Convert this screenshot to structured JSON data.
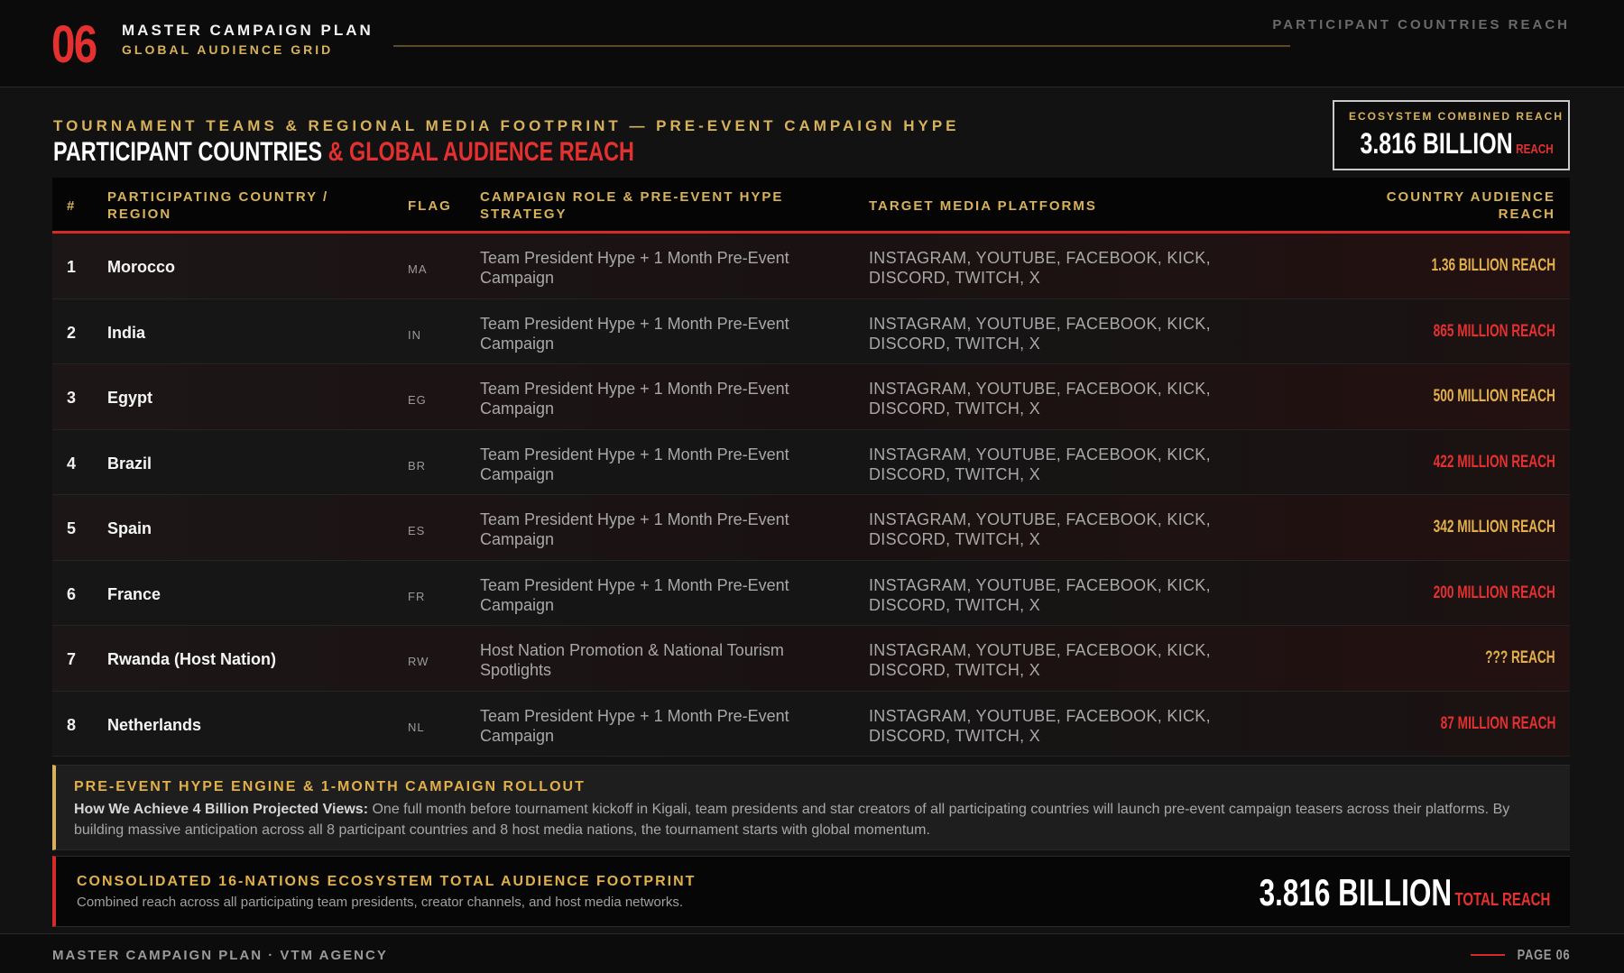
{
  "header": {
    "number": "06",
    "title": "MASTER CAMPAIGN PLAN",
    "subtitle": "GLOBAL AUDIENCE GRID",
    "right_label": "PARTICIPANT COUNTRIES REACH"
  },
  "section": {
    "kicker": "TOURNAMENT TEAMS & REGIONAL MEDIA FOOTPRINT — PRE-EVENT CAMPAIGN HYPE",
    "headline_white": "PARTICIPANT COUNTRIES ",
    "headline_red": "& GLOBAL AUDIENCE REACH"
  },
  "ecosystem": {
    "label": "ECOSYSTEM COMBINED REACH",
    "value": "3.816 BILLION",
    "unit": "REACH"
  },
  "table": {
    "headers": {
      "num": "#",
      "country": "PARTICIPATING COUNTRY / REGION",
      "flag": "FLAG",
      "role": "CAMPAIGN ROLE & PRE-EVENT HYPE STRATEGY",
      "platforms": "TARGET MEDIA PLATFORMS",
      "reach": "COUNTRY AUDIENCE REACH"
    },
    "rows": [
      {
        "num": "1",
        "country": "Morocco",
        "flag": "MA",
        "role": "Team President Hype + 1 Month Pre-Event Campaign",
        "platforms": "INSTAGRAM, YOUTUBE, FACEBOOK, KICK, DISCORD, TWITCH, X",
        "reach": "1.36 BILLION REACH",
        "reach_color": "gold"
      },
      {
        "num": "2",
        "country": "India",
        "flag": "IN",
        "role": "Team President Hype + 1 Month Pre-Event Campaign",
        "platforms": "INSTAGRAM, YOUTUBE, FACEBOOK, KICK, DISCORD, TWITCH, X",
        "reach": "865 MILLION REACH",
        "reach_color": "red"
      },
      {
        "num": "3",
        "country": "Egypt",
        "flag": "EG",
        "role": "Team President Hype + 1 Month Pre-Event Campaign",
        "platforms": "INSTAGRAM, YOUTUBE, FACEBOOK, KICK, DISCORD, TWITCH, X",
        "reach": "500 MILLION REACH",
        "reach_color": "gold"
      },
      {
        "num": "4",
        "country": "Brazil",
        "flag": "BR",
        "role": "Team President Hype + 1 Month Pre-Event Campaign",
        "platforms": "INSTAGRAM, YOUTUBE, FACEBOOK, KICK, DISCORD, TWITCH, X",
        "reach": "422 MILLION REACH",
        "reach_color": "red"
      },
      {
        "num": "5",
        "country": "Spain",
        "flag": "ES",
        "role": "Team President Hype + 1 Month Pre-Event Campaign",
        "platforms": "INSTAGRAM, YOUTUBE, FACEBOOK, KICK, DISCORD, TWITCH, X",
        "reach": "342 MILLION REACH",
        "reach_color": "gold"
      },
      {
        "num": "6",
        "country": "France",
        "flag": "FR",
        "role": "Team President Hype + 1 Month Pre-Event Campaign",
        "platforms": "INSTAGRAM, YOUTUBE, FACEBOOK, KICK, DISCORD, TWITCH, X",
        "reach": "200 MILLION REACH",
        "reach_color": "red"
      },
      {
        "num": "7",
        "country": "Rwanda (Host Nation)",
        "flag": "RW",
        "role": "Host Nation Promotion & National Tourism Spotlights",
        "platforms": "INSTAGRAM, YOUTUBE, FACEBOOK, KICK, DISCORD, TWITCH, X",
        "reach": "??? REACH",
        "reach_color": "gold"
      },
      {
        "num": "8",
        "country": "Netherlands",
        "flag": "NL",
        "role": "Team President Hype + 1 Month Pre-Event Campaign",
        "platforms": "INSTAGRAM, YOUTUBE, FACEBOOK, KICK, DISCORD, TWITCH, X",
        "reach": "87 MILLION REACH",
        "reach_color": "red"
      }
    ]
  },
  "engine": {
    "title": "PRE-EVENT HYPE ENGINE & 1-MONTH CAMPAIGN ROLLOUT",
    "lead": "How We Achieve 4 Billion Projected Views:",
    "body": " One full month before tournament kickoff in Kigali, team presidents and star creators of all participating countries will launch pre-event campaign teasers across their platforms. By building massive anticipation across all 8 participant countries and 8 host media nations, the tournament starts with global momentum."
  },
  "consolidated": {
    "title": "CONSOLIDATED 16-NATIONS ECOSYSTEM TOTAL AUDIENCE FOOTPRINT",
    "subtitle": "Combined reach across all participating team presidents, creator channels, and host media networks.",
    "value": "3.816 BILLION",
    "unit": "TOTAL REACH"
  },
  "footer": {
    "left": "MASTER CAMPAIGN PLAN · VTM AGENCY",
    "page": "PAGE 06"
  },
  "colors": {
    "accent_red": "#e53030",
    "accent_gold": "#d8b25a",
    "background": "#121212"
  }
}
